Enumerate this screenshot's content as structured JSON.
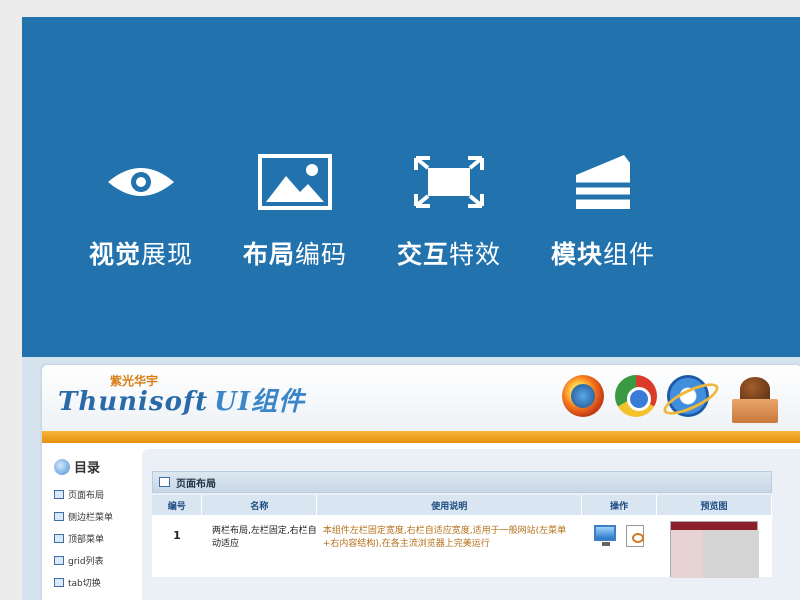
{
  "features": [
    {
      "bold": "视觉",
      "rest": "展现",
      "icon": "eye-icon"
    },
    {
      "bold": "布局",
      "rest": "编码",
      "icon": "image-icon"
    },
    {
      "bold": "交互",
      "rest": "特效",
      "icon": "expand-icon"
    },
    {
      "bold": "模块",
      "rest": "组件",
      "icon": "cake-icon"
    }
  ],
  "app": {
    "logo_cn": "紫光华宇",
    "logo_en": "Thunisoft",
    "logo_ui": "UI组件"
  },
  "sidebar": {
    "title": "目录",
    "items": [
      {
        "label": "页面布局"
      },
      {
        "label": "侧边栏菜单"
      },
      {
        "label": "顶部菜单"
      },
      {
        "label": "grid列表"
      },
      {
        "label": "tab切换"
      }
    ]
  },
  "main": {
    "section_title": "页面布局",
    "columns": [
      "编号",
      "名称",
      "使用说明",
      "操作",
      "预览图"
    ],
    "rows": [
      {
        "num": "1",
        "name": "两栏布局,左栏固定,右栏自动适应",
        "desc": "本组件左栏固定宽度,右栏自适应宽度,适用于一般网站(左菜单+右内容结构),在各主流浏览器上完美运行"
      }
    ]
  },
  "colors": {
    "banner": "#2273ad",
    "accent": "#f0a020"
  }
}
